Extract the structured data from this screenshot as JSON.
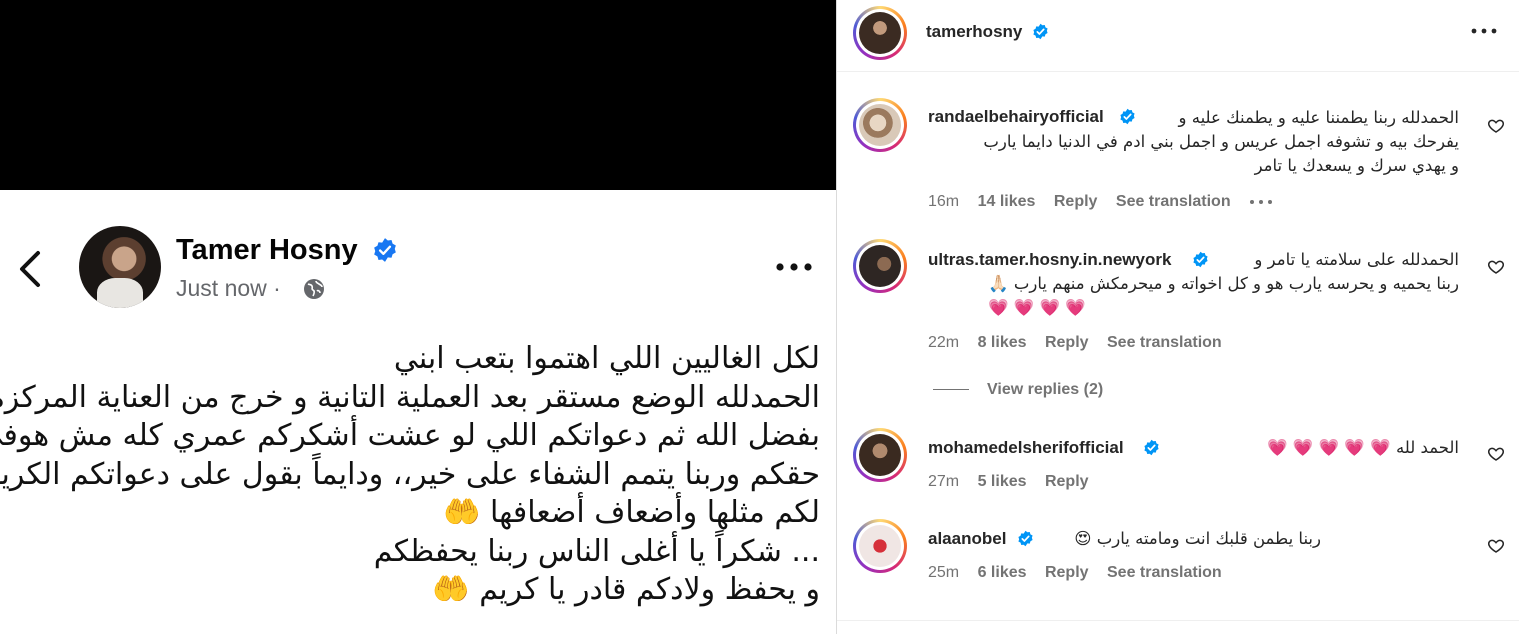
{
  "media": {
    "author_name": "Tamer Hosny",
    "time_label": "Just now",
    "separator": "·",
    "post_lines": [
      "لكل الغاليين اللي اهتموا بتعب ابني",
      "الحمدلله الوضع مستقر بعد العملية التانية و خرج من العناية المركزة",
      "بفضل الله ثم دعواتكم اللي لو عشت أشكركم عمري كله مش هوفي",
      "حقكم وربنا يتمم الشفاء على خير،، ودايماً بقول على دعواتكم الكريمة:",
      "لكم مثلها وأضعاف أضعافها 🤲",
      "... شكراً يا أغلى الناس ربنا يحفظكم",
      "و يحفظ ولادكم قادر يا كريم 🤲"
    ]
  },
  "header": {
    "username": "tamerhosny"
  },
  "comments": [
    {
      "username": "randaelbehairyofficial",
      "lines": [
        "الحمدلله ربنا يطمننا عليه و يطمنك عليه و",
        "يفرحك بيه و تشوفه اجمل عريس و اجمل بني ادم في الدنيا دايما يارب",
        "و يهدي سرك و يسعدك يا تامر"
      ],
      "time": "16m",
      "likes": "14 likes",
      "reply": "Reply",
      "see_translation": "See translation"
    },
    {
      "username": "ultras.tamer.hosny.in.newyork",
      "lines": [
        "الحمدلله على سلامته يا تامر و",
        "ربنا يحميه و يحرسه يارب هو و كل اخواته و ميحرمكش منهم يارب 🙏🏻",
        "💗 💗 💗 💗"
      ],
      "time": "22m",
      "likes": "8 likes",
      "reply": "Reply",
      "see_translation": "See translation",
      "view_replies": "View replies (2)"
    },
    {
      "username": "mohamedelsherifofficial",
      "lines": [
        "الحمد لله 💗 💗 💗 💗 💗"
      ],
      "time": "27m",
      "likes": "5 likes",
      "reply": "Reply"
    },
    {
      "username": "alaanobel",
      "lines": [
        "ربنا يطمن قلبك انت ومامته يارب 😍"
      ],
      "time": "25m",
      "likes": "6 likes",
      "reply": "Reply",
      "see_translation": "See translation"
    }
  ],
  "colors": {
    "verified_blue": "#0095f6",
    "fb_verified_blue": "#1877f2",
    "heart_pink": "#e0245e",
    "meta_gray": "#737373"
  },
  "icons": [
    "back-arrow-icon",
    "verified-badge-icon",
    "globe-icon",
    "more-options-icon",
    "heart-outline-icon"
  ]
}
